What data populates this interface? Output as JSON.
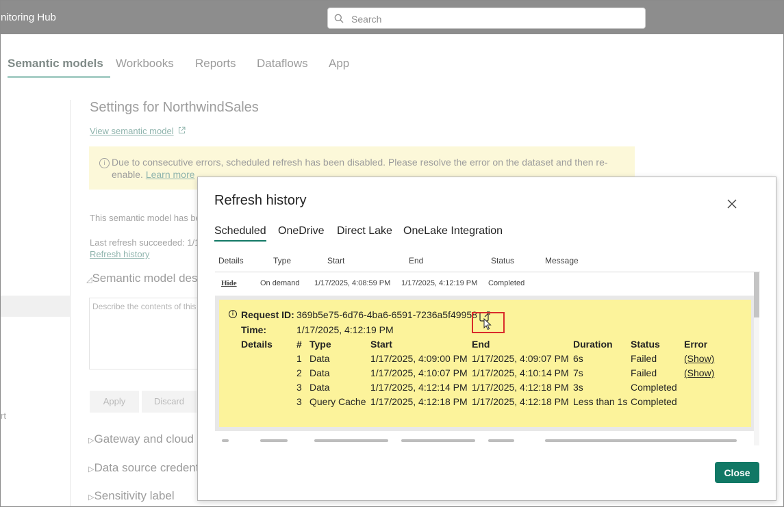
{
  "app": {
    "title_fragment": "nitoring Hub"
  },
  "search": {
    "placeholder": "Search"
  },
  "nav_tabs": [
    {
      "label": "Semantic models",
      "active": true
    },
    {
      "label": "Workbooks"
    },
    {
      "label": "Reports"
    },
    {
      "label": "Dataflows"
    },
    {
      "label": "App"
    }
  ],
  "left_panel": {
    "fragment": "rt"
  },
  "settings": {
    "title": "Settings for NorthwindSales",
    "view_link": "View semantic model",
    "banner": {
      "text": "Due to consecutive errors, scheduled refresh has been disabled. Please resolve the error on the dataset and then re-enable.",
      "learn_more": "Learn more"
    },
    "status_line": "This semantic model has be",
    "last_refresh": "Last refresh succeeded: 1/17",
    "refresh_history_link": "Refresh history",
    "section_description": "Semantic model des",
    "description_placeholder": "Describe the contents of this",
    "apply_label": "Apply",
    "discard_label": "Discard",
    "section_gateway": "Gateway and cloud c",
    "section_credentials": "Data source credent",
    "section_sensitivity": "Sensitivity label"
  },
  "dialog": {
    "title": "Refresh history",
    "tabs": [
      {
        "label": "Scheduled",
        "active": true
      },
      {
        "label": "OneDrive"
      },
      {
        "label": "Direct Lake"
      },
      {
        "label": "OneLake Integration"
      }
    ],
    "columns": [
      "Details",
      "Type",
      "Start",
      "End",
      "Status",
      "Message"
    ],
    "row": {
      "details": "Hide",
      "type": "On demand",
      "start": "1/17/2025, 4:08:59 PM",
      "end": "1/17/2025, 4:12:19 PM",
      "status": "Completed"
    },
    "detail": {
      "request_label": "Request ID:",
      "request_id": "369b5e75-6d76-4ba6-6591-7236a5f49958",
      "time_label": "Time:",
      "time_value": "1/17/2025, 4:12:19 PM",
      "details_label": "Details",
      "columns": [
        "#",
        "Type",
        "Start",
        "End",
        "Duration",
        "Status",
        "Error"
      ],
      "items": [
        {
          "num": "1",
          "type": "Data",
          "start": "1/17/2025, 4:09:00 PM",
          "end": "1/17/2025, 4:09:07 PM",
          "duration": "6s",
          "status": "Failed",
          "error": "(Show)"
        },
        {
          "num": "2",
          "type": "Data",
          "start": "1/17/2025, 4:10:07 PM",
          "end": "1/17/2025, 4:10:14 PM",
          "duration": "7s",
          "status": "Failed",
          "error": "(Show)"
        },
        {
          "num": "3",
          "type": "Data",
          "start": "1/17/2025, 4:12:14 PM",
          "end": "1/17/2025, 4:12:18 PM",
          "duration": "3s",
          "status": "Completed",
          "error": ""
        },
        {
          "num": "3",
          "type": "Query Cache",
          "start": "1/17/2025, 4:12:18 PM",
          "end": "1/17/2025, 4:12:18 PM",
          "duration": "Less than 1s",
          "status": "Completed",
          "error": ""
        }
      ]
    },
    "close_label": "Close"
  },
  "icons": {
    "search": "search-icon",
    "external_link": "external-link-icon",
    "info": "info-icon",
    "close": "close-icon",
    "copy": "copy-icon",
    "cursor": "mouse-cursor-icon"
  },
  "colors": {
    "accent": "#117865",
    "banner_bg": "#fcf8d9",
    "detail_bg": "#fcf39b",
    "highlight_border": "#d92b2b",
    "topbar": "#8d8d8d"
  }
}
